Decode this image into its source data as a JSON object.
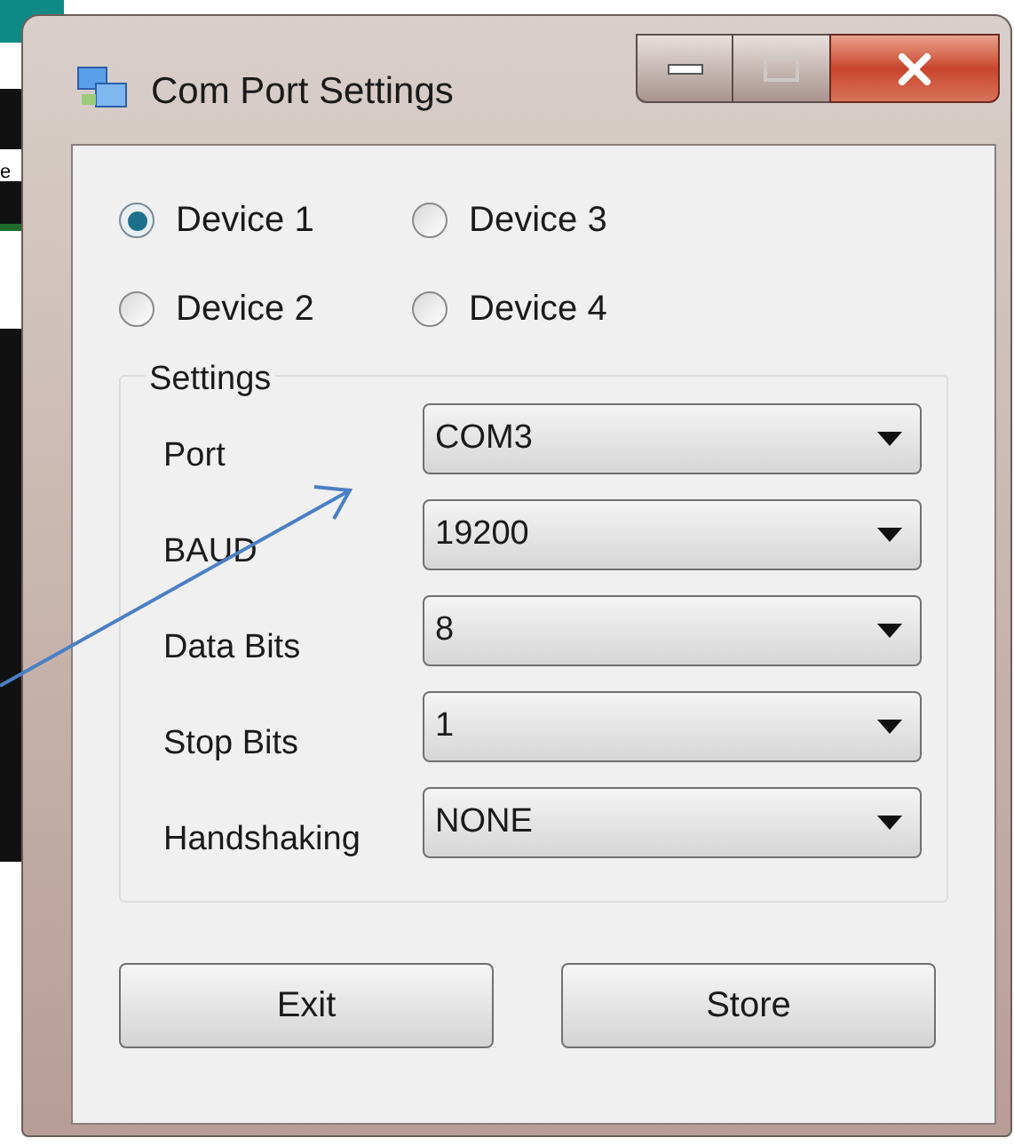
{
  "backdrop": {
    "text": "e"
  },
  "window": {
    "title": "Com Port Settings"
  },
  "devices": [
    {
      "label": "Device 1",
      "selected": true
    },
    {
      "label": "Device 2",
      "selected": false
    },
    {
      "label": "Device 3",
      "selected": false
    },
    {
      "label": "Device 4",
      "selected": false
    }
  ],
  "settings": {
    "title": "Settings",
    "fields": [
      {
        "label": "Port",
        "value": "COM3"
      },
      {
        "label": "BAUD",
        "value": "19200"
      },
      {
        "label": "Data Bits",
        "value": "8"
      },
      {
        "label": "Stop Bits",
        "value": "1"
      },
      {
        "label": "Handshaking",
        "value": "NONE"
      }
    ]
  },
  "buttons": [
    "Exit",
    "Store"
  ]
}
